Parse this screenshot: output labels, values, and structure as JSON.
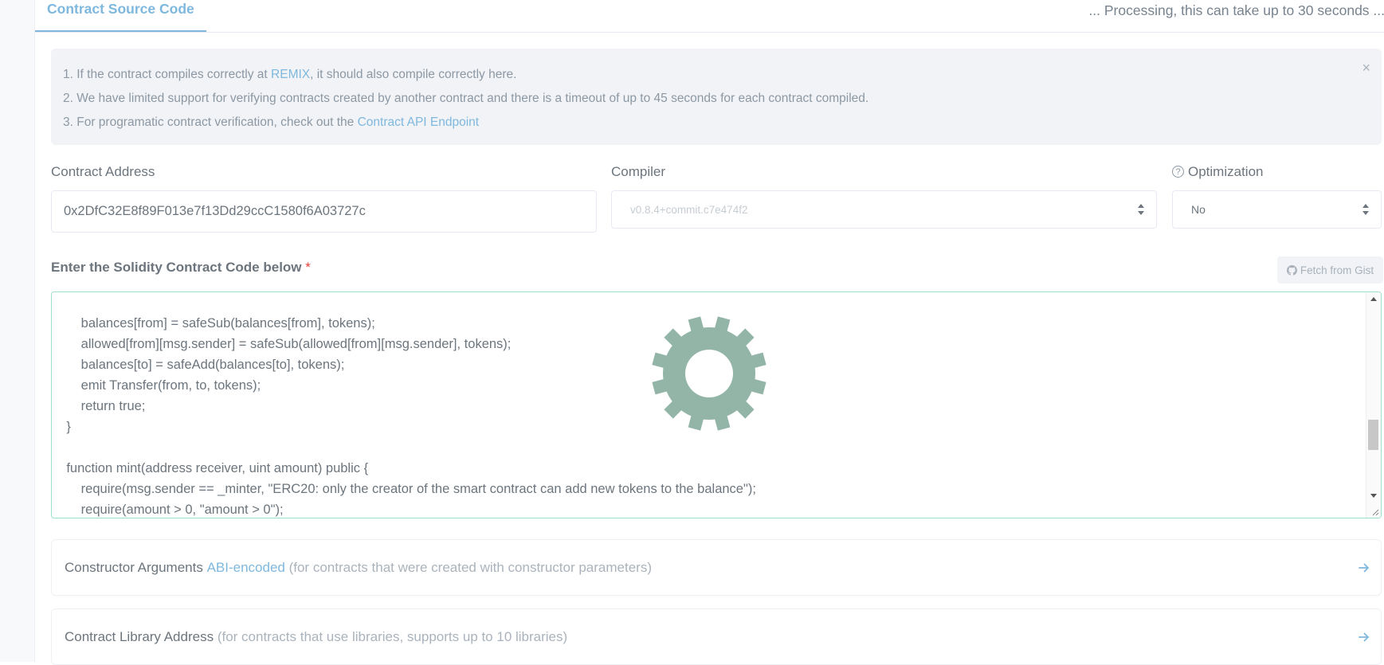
{
  "tab": {
    "label": "Contract Source Code"
  },
  "status": {
    "processing": "... Processing, this can take up to 30 seconds ..."
  },
  "info": {
    "line1_pre": "1. If the contract compiles correctly at ",
    "line1_link": "REMIX",
    "line1_post": ", it should also compile correctly here.",
    "line2": "2. We have limited support for verifying contracts created by another contract and there is a timeout of up to 45 seconds for each contract compiled.",
    "line3_pre": "3. For programatic contract verification, check out the ",
    "line3_link": "Contract API Endpoint",
    "close": "×"
  },
  "form": {
    "address_label": "Contract Address",
    "address_value": "0x2DfC32E8f89F013e7f13Dd29ccC1580f6A03727c",
    "compiler_label": "Compiler",
    "compiler_value": "v0.8.4+commit.c7e474f2",
    "optimization_label": "Optimization",
    "optimization_help": "?",
    "optimization_value": "No"
  },
  "code_section": {
    "title": "Enter the Solidity Contract Code below",
    "required_mark": "*",
    "gist_button": "Fetch from Gist",
    "lines": [
      "        balances[from] = safeSub(balances[from], tokens);",
      "        allowed[from][msg.sender] = safeSub(allowed[from][msg.sender], tokens);",
      "        balances[to] = safeAdd(balances[to], tokens);",
      "        emit Transfer(from, to, tokens);",
      "        return true;",
      "    }",
      "",
      "    function mint(address receiver, uint amount) public {",
      "        require(msg.sender == _minter, \"ERC20: only the creator of the smart contract can add new tokens to the balance\");",
      "        require(amount > 0, \"amount > 0\");"
    ]
  },
  "constructor_panel": {
    "label": "Constructor Arguments ",
    "link": "ABI-encoded",
    "note": " (for contracts that were created with constructor parameters)"
  },
  "library_panel": {
    "label": "Contract Library Address ",
    "note": "(for contracts that use libraries, supports up to 10 libraries)"
  },
  "colors": {
    "accent": "#7fb8de",
    "spinner": "#93b5a8",
    "code_border": "#9edfc9",
    "required": "#de4437"
  },
  "icons": {
    "close": "close-icon",
    "select": "select-arrows-icon",
    "help": "question-circle-icon",
    "github": "github-icon",
    "spinner": "gear-icon",
    "panel_arrow": "arrow-right-icon"
  }
}
